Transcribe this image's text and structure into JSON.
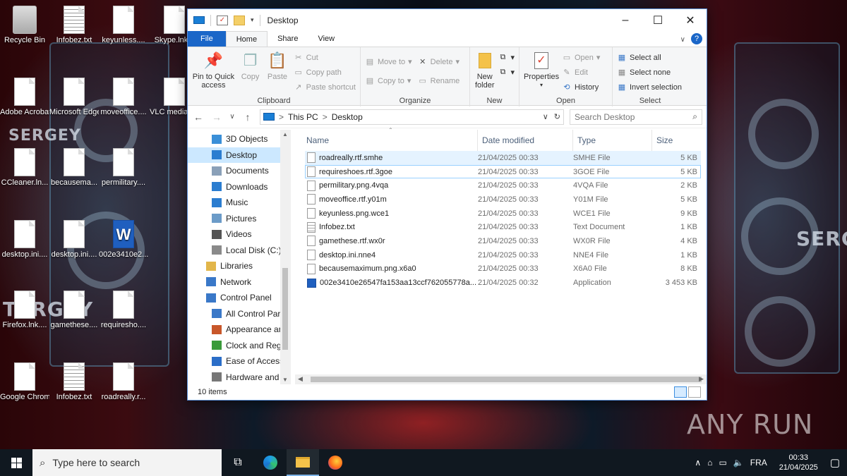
{
  "desktop": {
    "icons": [
      {
        "label": "Recycle Bin",
        "type": "bin"
      },
      {
        "label": "Infobez.txt",
        "type": "txt"
      },
      {
        "label": "keyunless....",
        "type": "doc"
      },
      {
        "label": "Skype.lnk.p",
        "type": "doc"
      },
      {
        "label": "Adobe Acrobat.ln...",
        "type": "doc"
      },
      {
        "label": "Microsoft Edge.lnk.l...",
        "type": "doc"
      },
      {
        "label": "moveoffice....",
        "type": "doc"
      },
      {
        "label": "VLC media player.lnk...",
        "type": "doc"
      },
      {
        "label": "CCleaner.ln...",
        "type": "doc"
      },
      {
        "label": "becausema...",
        "type": "doc"
      },
      {
        "label": "permilitary....",
        "type": "doc"
      },
      {
        "label": "desktop.ini....",
        "type": "doc"
      },
      {
        "label": "desktop.ini....",
        "type": "doc"
      },
      {
        "label": "002e3410e2...",
        "type": "word"
      },
      {
        "label": "Firefox.lnk....",
        "type": "doc"
      },
      {
        "label": "gamethese....",
        "type": "doc"
      },
      {
        "label": "requiresho....",
        "type": "doc"
      },
      {
        "label": "Google Chrome.lnk...",
        "type": "doc"
      },
      {
        "label": "Infobez.txt",
        "type": "txt"
      },
      {
        "label": "roadreally.r...",
        "type": "doc"
      }
    ],
    "wallpaper_text": [
      "SERGEY",
      "SERGEY",
      "TERGEY"
    ]
  },
  "window": {
    "title": "Desktop",
    "tabs": {
      "file": "File",
      "home": "Home",
      "share": "Share",
      "view": "View"
    },
    "help": "?",
    "ribbon": {
      "clipboard": {
        "name": "Clipboard",
        "pin": "Pin to Quick access",
        "copy": "Copy",
        "paste": "Paste",
        "cut": "Cut",
        "copy_path": "Copy path",
        "paste_shortcut": "Paste shortcut"
      },
      "organize": {
        "name": "Organize",
        "move_to": "Move to",
        "copy_to": "Copy to",
        "delete": "Delete",
        "rename": "Rename"
      },
      "new": {
        "name": "New",
        "new_folder": "New folder"
      },
      "open": {
        "name": "Open",
        "properties": "Properties",
        "open": "Open",
        "edit": "Edit",
        "history": "History"
      },
      "select": {
        "name": "Select",
        "select_all": "Select all",
        "select_none": "Select none",
        "invert": "Invert selection"
      }
    },
    "address": {
      "this_pc": "This PC",
      "desktop": "Desktop",
      "sep": ">"
    },
    "search_placeholder": "Search Desktop",
    "nav_items": [
      {
        "label": "3D Objects",
        "icon": "3d-objects-icon",
        "color": "#3a8fd8",
        "indent": 34
      },
      {
        "label": "Desktop",
        "icon": "desktop-folder-icon",
        "color": "#2b7dd0",
        "indent": 34,
        "selected": true
      },
      {
        "label": "Documents",
        "icon": "documents-icon",
        "color": "#8aa0b8",
        "indent": 34
      },
      {
        "label": "Downloads",
        "icon": "downloads-icon",
        "color": "#2b7dd0",
        "indent": 34
      },
      {
        "label": "Music",
        "icon": "music-icon",
        "color": "#2b7dd0",
        "indent": 34
      },
      {
        "label": "Pictures",
        "icon": "pictures-icon",
        "color": "#6b9bc8",
        "indent": 34
      },
      {
        "label": "Videos",
        "icon": "videos-icon",
        "color": "#555",
        "indent": 34
      },
      {
        "label": "Local Disk (C:)",
        "icon": "disk-icon",
        "color": "#8a8a8a",
        "indent": 34
      },
      {
        "label": "Libraries",
        "icon": "libraries-icon",
        "color": "#e2b64a",
        "indent": 26
      },
      {
        "label": "Network",
        "icon": "network-icon",
        "color": "#3a78c8",
        "indent": 26
      },
      {
        "label": "Control Panel",
        "icon": "control-panel-icon",
        "color": "#3a78c8",
        "indent": 26
      },
      {
        "label": "All Control Par",
        "icon": "control-panel-icon",
        "color": "#3a78c8",
        "indent": 34
      },
      {
        "label": "Appearance an",
        "icon": "appearance-icon",
        "color": "#c8572a",
        "indent": 34
      },
      {
        "label": "Clock and Regi",
        "icon": "clock-icon",
        "color": "#3a9a3a",
        "indent": 34
      },
      {
        "label": "Ease of Access",
        "icon": "ease-of-access-icon",
        "color": "#2b6ec8",
        "indent": 34
      },
      {
        "label": "Hardware and",
        "icon": "hardware-icon",
        "color": "#777",
        "indent": 34
      }
    ],
    "columns": {
      "name": "Name",
      "date": "Date modified",
      "type": "Type",
      "size": "Size"
    },
    "files": [
      {
        "name": "roadreally.rtf.smhe",
        "date": "21/04/2025 00:33",
        "type": "SMHE File",
        "size": "5 KB",
        "icon": "file"
      },
      {
        "name": "requireshoes.rtf.3goe",
        "date": "21/04/2025 00:33",
        "type": "3GOE File",
        "size": "5 KB",
        "icon": "file"
      },
      {
        "name": "permilitary.png.4vqa",
        "date": "21/04/2025 00:33",
        "type": "4VQA File",
        "size": "2 KB",
        "icon": "file"
      },
      {
        "name": "moveoffice.rtf.y01m",
        "date": "21/04/2025 00:33",
        "type": "Y01M File",
        "size": "5 KB",
        "icon": "file"
      },
      {
        "name": "keyunless.png.wce1",
        "date": "21/04/2025 00:33",
        "type": "WCE1 File",
        "size": "9 KB",
        "icon": "file"
      },
      {
        "name": "Infobez.txt",
        "date": "21/04/2025 00:33",
        "type": "Text Document",
        "size": "1 KB",
        "icon": "txt"
      },
      {
        "name": "gamethese.rtf.wx0r",
        "date": "21/04/2025 00:33",
        "type": "WX0R File",
        "size": "4 KB",
        "icon": "file"
      },
      {
        "name": "desktop.ini.nne4",
        "date": "21/04/2025 00:33",
        "type": "NNE4 File",
        "size": "1 KB",
        "icon": "file"
      },
      {
        "name": "becausemaximum.png.x6a0",
        "date": "21/04/2025 00:33",
        "type": "X6A0 File",
        "size": "8 KB",
        "icon": "file"
      },
      {
        "name": "002e3410e26547fa153aa13ccf762055778a...",
        "date": "21/04/2025 00:32",
        "type": "Application",
        "size": "3 453 KB",
        "icon": "app"
      }
    ],
    "status": "10 items"
  },
  "taskbar": {
    "search_placeholder": "Type here to search",
    "lang": "FRA",
    "time": "00:33",
    "date": "21/04/2025"
  },
  "watermark": "ANY RUN"
}
